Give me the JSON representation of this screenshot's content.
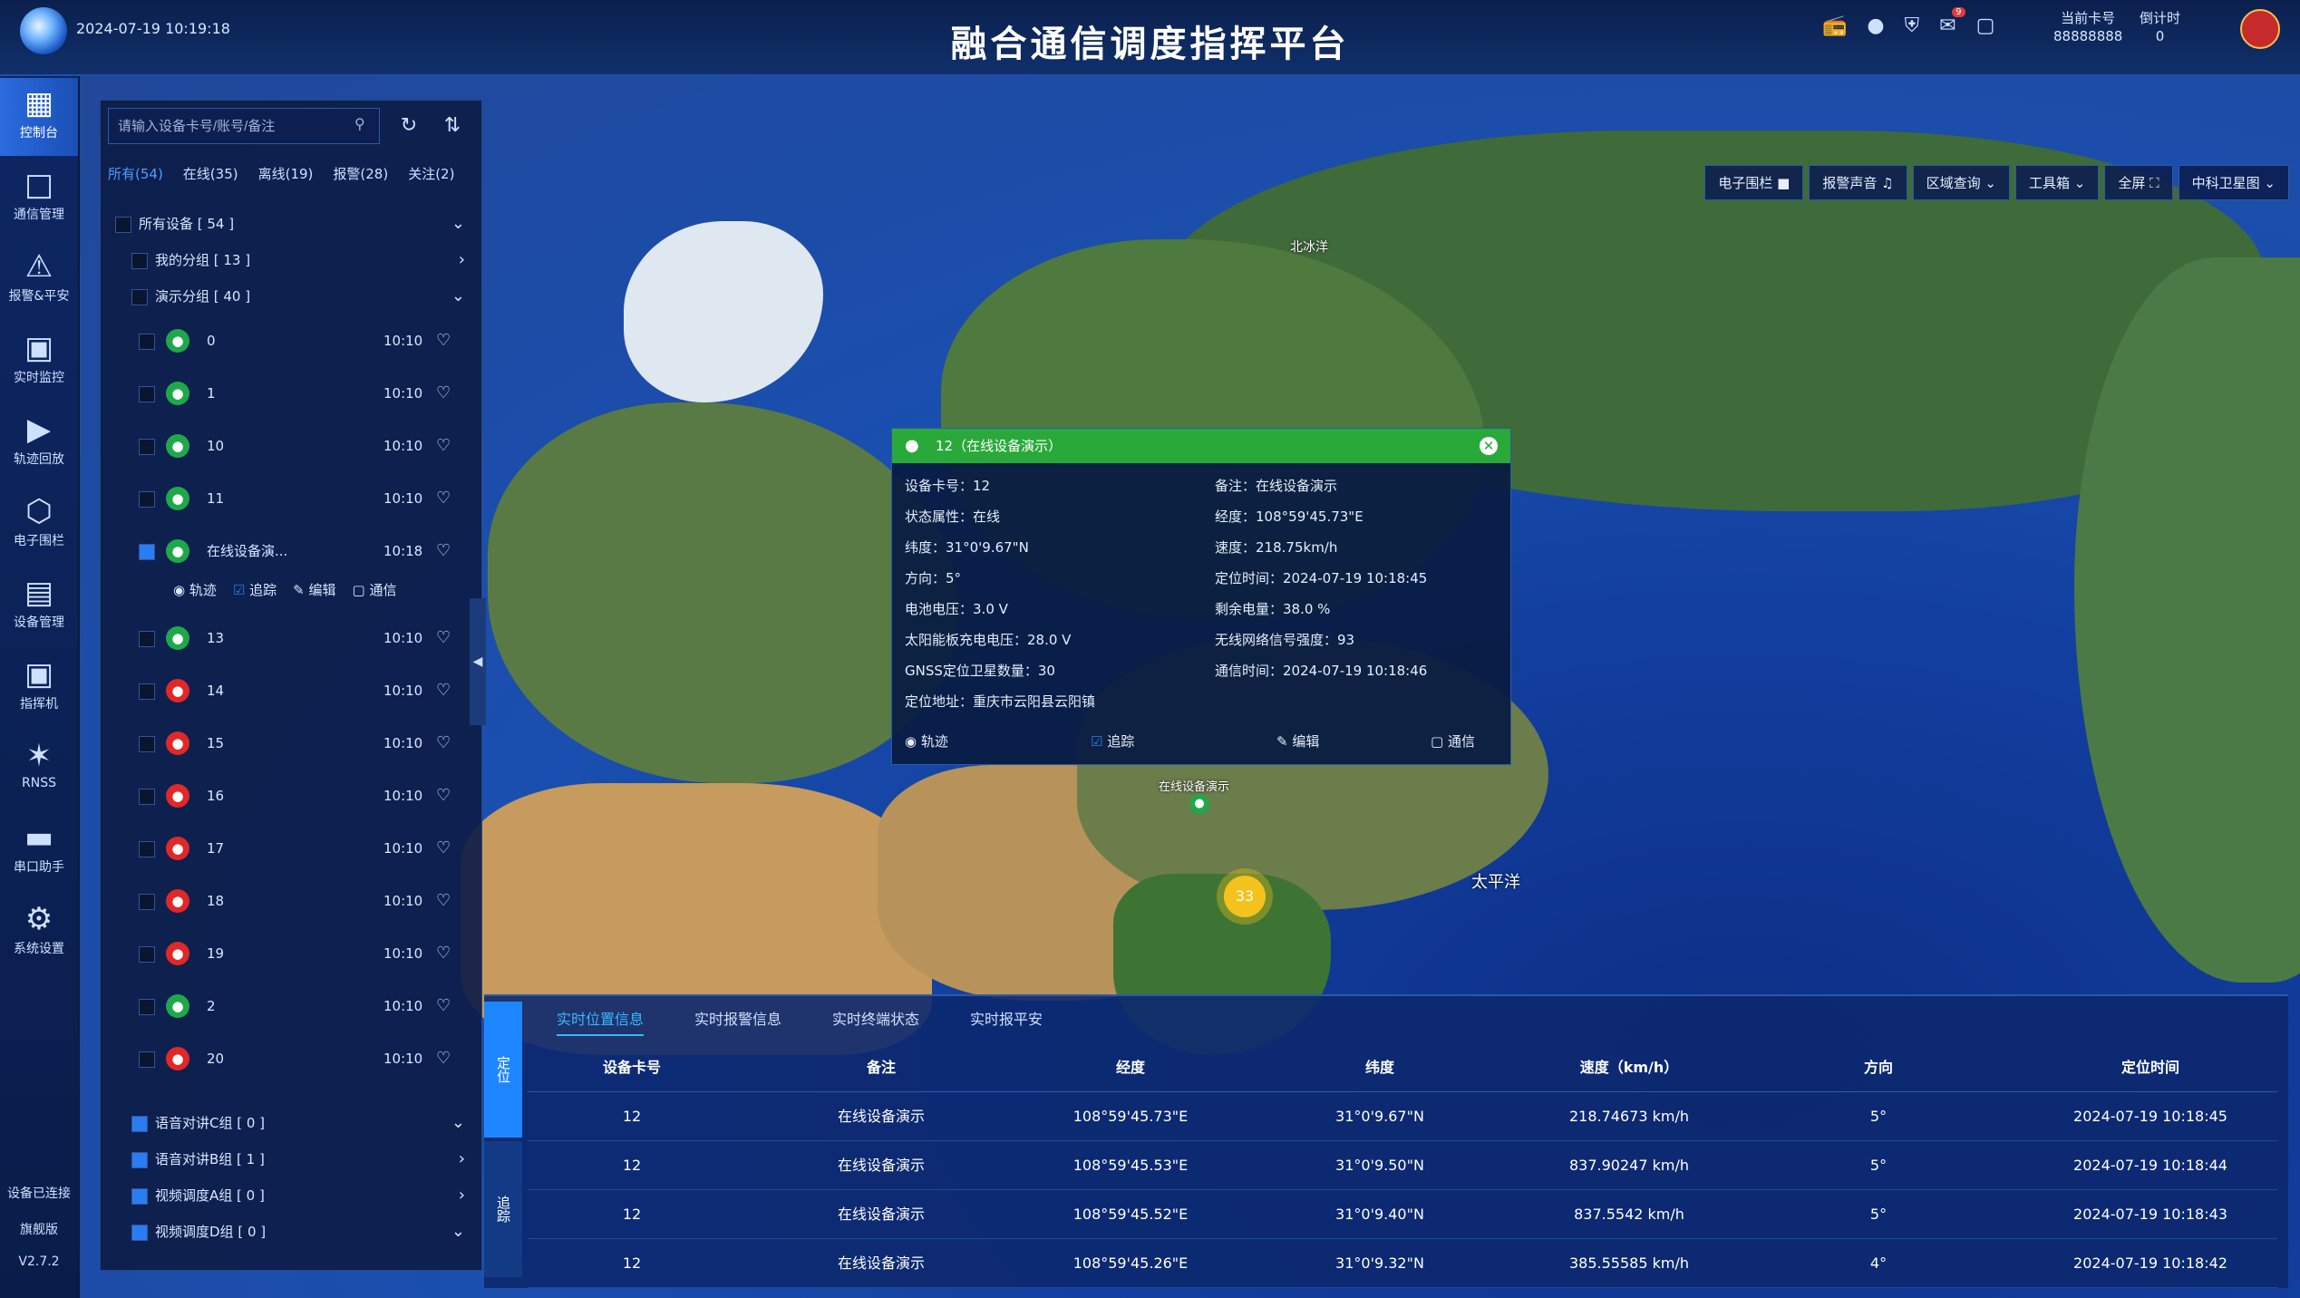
{
  "header": {
    "datetime": "2024-07-19 10:19:18",
    "title": "融合通信调度指挥平台",
    "stats": [
      {
        "label": "当前卡号",
        "value": "88888888"
      },
      {
        "label": "倒计时",
        "value": "0"
      }
    ],
    "message_badge": "9"
  },
  "nav": {
    "items": [
      {
        "label": "控制台",
        "icon": "grid-icon"
      },
      {
        "label": "通信管理",
        "icon": "chat-icon"
      },
      {
        "label": "报警&平安",
        "icon": "alarm-icon"
      },
      {
        "label": "实时监控",
        "icon": "monitor-icon"
      },
      {
        "label": "轨迹回放",
        "icon": "replay-icon"
      },
      {
        "label": "电子围栏",
        "icon": "fence-icon"
      },
      {
        "label": "设备管理",
        "icon": "device-icon"
      },
      {
        "label": "指挥机",
        "icon": "commander-icon"
      },
      {
        "label": "RNSS",
        "icon": "satellite-icon"
      },
      {
        "label": "串口助手",
        "icon": "serial-icon"
      },
      {
        "label": "系统设置",
        "icon": "gear-icon"
      }
    ],
    "footer": {
      "connection": "设备已连接",
      "edition": "旗舰版",
      "version": "V2.7.2"
    }
  },
  "device_panel": {
    "search_placeholder": "请输入设备卡号/账号/备注",
    "filters": [
      "所有(54)",
      "在线(35)",
      "离线(19)",
      "报警(28)",
      "关注(2)"
    ],
    "groups_top": [
      {
        "label": "所有设备 [ 54 ]"
      },
      {
        "label": "我的分组 [ 13 ]"
      },
      {
        "label": "演示分组 [ 40 ]"
      }
    ],
    "devices": [
      {
        "name": "0",
        "time": "10:10",
        "status": "online"
      },
      {
        "name": "1",
        "time": "10:10",
        "status": "online"
      },
      {
        "name": "10",
        "time": "10:10",
        "status": "online"
      },
      {
        "name": "11",
        "time": "10:10",
        "status": "online"
      },
      {
        "name": "在线设备演...",
        "time": "10:18",
        "status": "online"
      },
      {
        "name": "13",
        "time": "10:10",
        "status": "online"
      },
      {
        "name": "14",
        "time": "10:10",
        "status": "alarm"
      },
      {
        "name": "15",
        "time": "10:10",
        "status": "alarm"
      },
      {
        "name": "16",
        "time": "10:10",
        "status": "alarm"
      },
      {
        "name": "17",
        "time": "10:10",
        "status": "alarm"
      },
      {
        "name": "18",
        "time": "10:10",
        "status": "alarm"
      },
      {
        "name": "19",
        "time": "10:10",
        "status": "alarm"
      },
      {
        "name": "2",
        "time": "10:10",
        "status": "online"
      },
      {
        "name": "20",
        "time": "10:10",
        "status": "alarm"
      }
    ],
    "row_actions": [
      "轨迹",
      "追踪",
      "编辑",
      "通信"
    ],
    "groups_bottom": [
      {
        "label": "语音对讲C组 [ 0 ]"
      },
      {
        "label": "语音对讲B组 [ 1 ]"
      },
      {
        "label": "视频调度A组 [ 0 ]"
      },
      {
        "label": "视频调度D组 [ 0 ]"
      }
    ]
  },
  "map_toolbar": [
    "电子围栏",
    "报警声音",
    "区域查询",
    "工具箱",
    "全屏",
    "中科卫星图"
  ],
  "map_labels": [
    {
      "text": "太平洋"
    },
    {
      "text": "北冰洋"
    },
    {
      "text": "在线设备演示"
    }
  ],
  "cluster_count": "33",
  "popup": {
    "title": "12（在线设备演示）",
    "fields": [
      {
        "k": "设备卡号：",
        "v": "12"
      },
      {
        "k": "备注：",
        "v": "在线设备演示"
      },
      {
        "k": "状态属性：",
        "v": "在线"
      },
      {
        "k": "经度：",
        "v": "108°59'45.73\"E"
      },
      {
        "k": "纬度：",
        "v": "31°0'9.67\"N"
      },
      {
        "k": "速度：",
        "v": "218.75km/h"
      },
      {
        "k": "方向：",
        "v": "5°"
      },
      {
        "k": "定位时间：",
        "v": "2024-07-19 10:18:45"
      },
      {
        "k": "电池电压：",
        "v": "3.0 V"
      },
      {
        "k": "剩余电量：",
        "v": "38.0 %"
      },
      {
        "k": "太阳能板充电电压：",
        "v": "28.0 V"
      },
      {
        "k": "无线网络信号强度：",
        "v": "93"
      },
      {
        "k": "GNSS定位卫星数量：",
        "v": "30"
      },
      {
        "k": "通信时间：",
        "v": "2024-07-19 10:18:46"
      },
      {
        "k": "定位地址：",
        "v": "重庆市云阳县云阳镇"
      }
    ],
    "actions": [
      "轨迹",
      "追踪",
      "编辑",
      "通信"
    ]
  },
  "bottom_panel": {
    "side_tabs": [
      "定位",
      "追踪"
    ],
    "tabs": [
      "实时位置信息",
      "实时报警信息",
      "实时终端状态",
      "实时报平安"
    ],
    "columns": [
      "设备卡号",
      "备注",
      "经度",
      "纬度",
      "速度（km/h）",
      "方向",
      "定位时间"
    ],
    "rows": [
      [
        "12",
        "在线设备演示",
        "108°59'45.73\"E",
        "31°0'9.67\"N",
        "218.74673 km/h",
        "5°",
        "2024-07-19 10:18:45"
      ],
      [
        "12",
        "在线设备演示",
        "108°59'45.53\"E",
        "31°0'9.50\"N",
        "837.90247 km/h",
        "5°",
        "2024-07-19 10:18:44"
      ],
      [
        "12",
        "在线设备演示",
        "108°59'45.52\"E",
        "31°0'9.40\"N",
        "837.5542 km/h",
        "5°",
        "2024-07-19 10:18:43"
      ],
      [
        "12",
        "在线设备演示",
        "108°59'45.26\"E",
        "31°0'9.32\"N",
        "385.55585 km/h",
        "4°",
        "2024-07-19 10:18:42"
      ]
    ]
  }
}
